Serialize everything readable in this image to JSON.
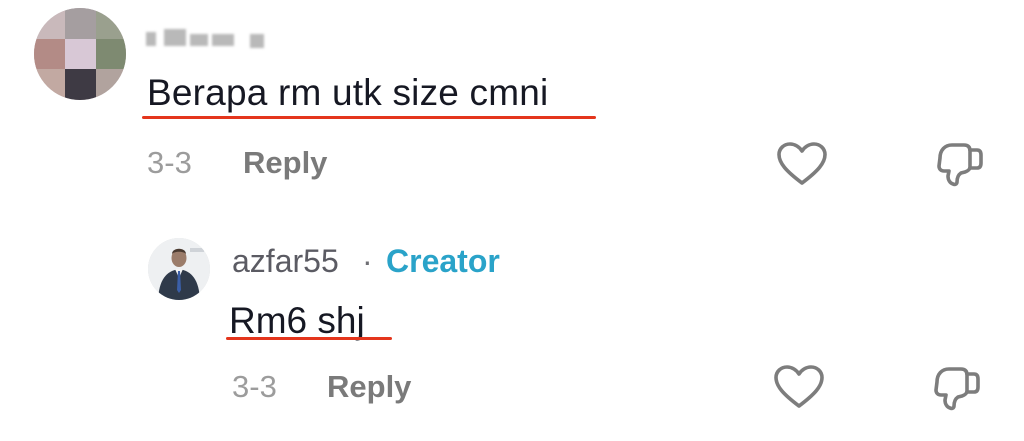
{
  "comment": {
    "username": "",
    "text": "Berapa rm utk size cmni",
    "date": "3-3",
    "reply_label": "Reply",
    "avatar_icon": "user-avatar-pixelated",
    "like_icon": "heart-icon",
    "dislike_icon": "thumbs-down-icon"
  },
  "reply": {
    "username": "azfar55",
    "separator": "·",
    "badge": "Creator",
    "text": "Rm6 shj",
    "date": "3-3",
    "reply_label": "Reply",
    "avatar_icon": "user-avatar",
    "like_icon": "heart-icon",
    "dislike_icon": "thumbs-down-icon"
  },
  "colors": {
    "text": "#161823",
    "meta": "#9c9c9c",
    "reply_label": "#7a7a7a",
    "creator_badge": "#2aa3c9",
    "underline": "#e4351c"
  }
}
